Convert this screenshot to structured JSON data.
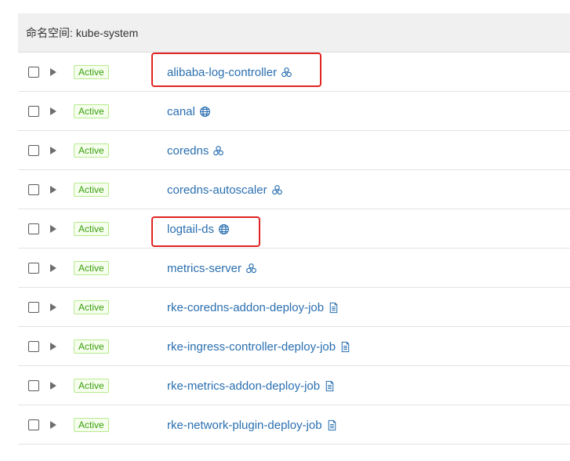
{
  "namespace": {
    "label": "命名空间:",
    "value": "kube-system"
  },
  "colors": {
    "link": "#2a6fb0",
    "highlight": "#e02424",
    "active_text": "#389e0d",
    "active_bg": "#f6ffed",
    "active_border": "#b7eb8f"
  },
  "rows": [
    {
      "status": "Active",
      "name": "alibaba-log-controller",
      "icon": "deployment-icon"
    },
    {
      "status": "Active",
      "name": "canal",
      "icon": "daemonset-icon"
    },
    {
      "status": "Active",
      "name": "coredns",
      "icon": "deployment-icon"
    },
    {
      "status": "Active",
      "name": "coredns-autoscaler",
      "icon": "deployment-icon"
    },
    {
      "status": "Active",
      "name": "logtail-ds",
      "icon": "daemonset-icon"
    },
    {
      "status": "Active",
      "name": "metrics-server",
      "icon": "deployment-icon"
    },
    {
      "status": "Active",
      "name": "rke-coredns-addon-deploy-job",
      "icon": "job-icon"
    },
    {
      "status": "Active",
      "name": "rke-ingress-controller-deploy-job",
      "icon": "job-icon"
    },
    {
      "status": "Active",
      "name": "rke-metrics-addon-deploy-job",
      "icon": "job-icon"
    },
    {
      "status": "Active",
      "name": "rke-network-plugin-deploy-job",
      "icon": "job-icon"
    }
  ]
}
